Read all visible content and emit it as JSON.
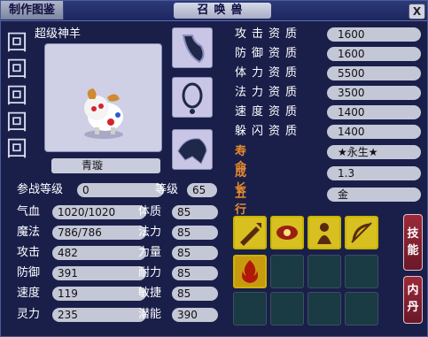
{
  "window": {
    "tab_label": "制作图鉴",
    "title": "召唤兽",
    "close_label": "X"
  },
  "pet": {
    "type_name": "超级神羊",
    "name": "青璇"
  },
  "stats_right": [
    {
      "label": "攻击资质",
      "value": "1600"
    },
    {
      "label": "防御资质",
      "value": "1600"
    },
    {
      "label": "体力资质",
      "value": "5500"
    },
    {
      "label": "法力资质",
      "value": "3500"
    },
    {
      "label": "速度资质",
      "value": "1400"
    },
    {
      "label": "躲闪资质",
      "value": "1400"
    }
  ],
  "lifespan": {
    "label": "寿命",
    "value": "★永生★"
  },
  "growth": {
    "label": "成长",
    "value": "1.3"
  },
  "element": {
    "label": "五行",
    "value": "金"
  },
  "battle_level": {
    "label": "参战等级",
    "value": "0"
  },
  "level": {
    "label": "等级",
    "value": "65"
  },
  "stats_left": [
    {
      "label": "气血",
      "value": "1020/1020"
    },
    {
      "label": "魔法",
      "value": "786/786"
    },
    {
      "label": "攻击",
      "value": "482"
    },
    {
      "label": "防御",
      "value": "391"
    },
    {
      "label": "速度",
      "value": "119"
    },
    {
      "label": "灵力",
      "value": "235"
    }
  ],
  "attributes": [
    {
      "label": "体质",
      "value": "85"
    },
    {
      "label": "法力",
      "value": "85"
    },
    {
      "label": "力量",
      "value": "85"
    },
    {
      "label": "耐力",
      "value": "85"
    },
    {
      "label": "敏捷",
      "value": "85"
    },
    {
      "label": "潜能",
      "value": "390"
    }
  ],
  "buttons": {
    "skills": "技能",
    "inner_pill": "内丹"
  },
  "icons": [
    "necklace-equip-icon",
    "ring-equip-icon",
    "armor-equip-icon",
    "sword-skill-icon",
    "eye-skill-icon",
    "figure-skill-icon",
    "bow-skill-icon",
    "fire-skill-icon"
  ]
}
